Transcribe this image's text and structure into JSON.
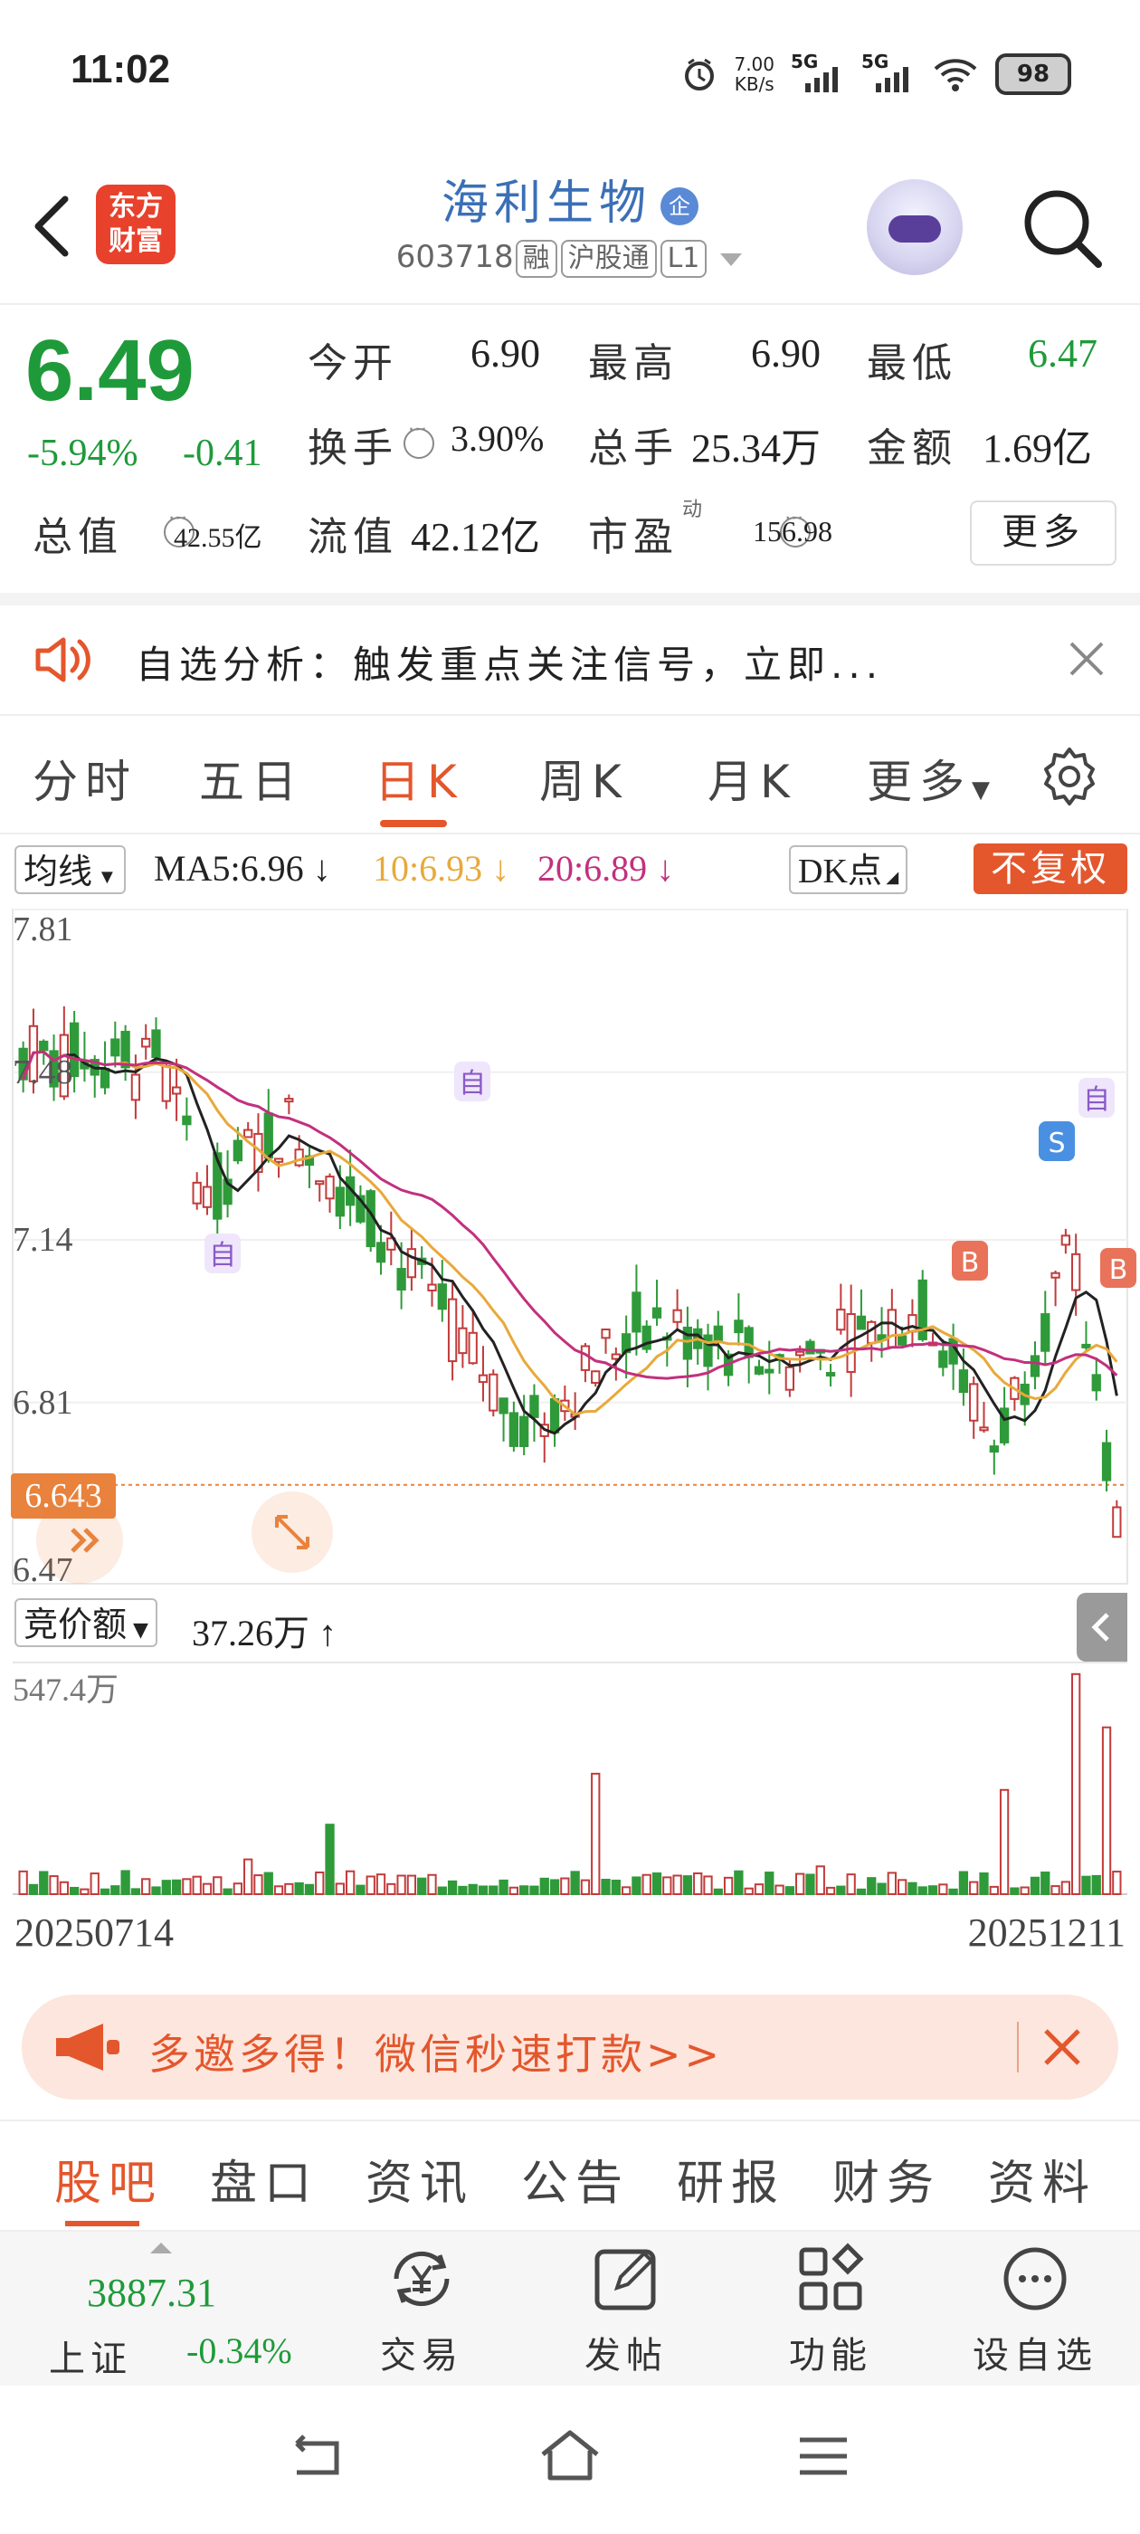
{
  "status": {
    "time": "11:02",
    "speed": "7.00",
    "speed_unit": "KB/s",
    "net1": "5G",
    "net2": "5G",
    "battery": "98"
  },
  "header": {
    "logo_line1": "东方",
    "logo_line2": "财富",
    "stock_name": "海利生物",
    "qi_badge": "企",
    "code": "603718",
    "tag_rong": "融",
    "tag_hgt": "沪股通",
    "tag_l1": "L1"
  },
  "quote": {
    "price": "6.49",
    "change_pct": "-5.94%",
    "change": "-0.41",
    "open_label": "今开",
    "open": "6.90",
    "high_label": "最高",
    "high": "6.90",
    "low_label": "最低",
    "low": "6.47",
    "turnover_label": "换手",
    "turnover": "3.90%",
    "volume_label": "总手",
    "volume": "25.34万",
    "amount_label": "金额",
    "amount": "1.69亿",
    "mktcap_label": "总值",
    "mktcap": "42.55亿",
    "float_label": "流值",
    "float_cap": "42.12亿",
    "pe_label": "市盈",
    "pe_sup": "动",
    "pe": "156.98",
    "more": "更多"
  },
  "analysis": {
    "text": "自选分析：触发重点关注信号，立即..."
  },
  "tabs": [
    "分时",
    "五日",
    "日K",
    "周K",
    "月K",
    "更多"
  ],
  "active_tab": "日K",
  "ma": {
    "selector": "均线",
    "ma5": "MA5:6.96",
    "ma10": "10:6.93",
    "ma20": "20:6.89",
    "dk": "DK点",
    "fq": "不复权",
    "color_ma5": "#222222",
    "color_ma10": "#e8a93a",
    "color_ma20": "#c2307e"
  },
  "kline": {
    "y_labels": [
      "7.81",
      "7.48",
      "7.14",
      "6.81",
      "6.47"
    ],
    "current_tag": "6.643",
    "markers": {
      "zi": "自",
      "s": "S",
      "b": "B"
    }
  },
  "volume": {
    "selector": "竞价额",
    "value": "37.26万",
    "max_label": "547.4万"
  },
  "dates": {
    "start": "20250714",
    "end": "20251211"
  },
  "promo": {
    "text": "多邀多得！微信秒速打款>>"
  },
  "bottom_tabs": [
    "股吧",
    "盘口",
    "资讯",
    "公告",
    "研报",
    "财务",
    "资料"
  ],
  "dock": {
    "index_value": "3887.31",
    "index_name": "上证",
    "index_change": "-0.34%",
    "trade": "交易",
    "post": "发帖",
    "func": "功能",
    "watch": "设自选"
  },
  "colors": {
    "accent": "#e4562c",
    "up": "#c23b3b",
    "down": "#2f9a3a",
    "brand_blue": "#3b6fb6"
  }
}
